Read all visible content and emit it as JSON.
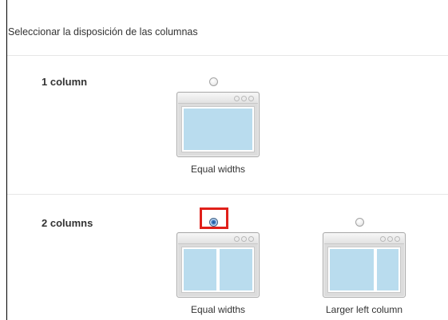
{
  "header": {
    "title": "Seleccionar la disposición de las columnas"
  },
  "rows": [
    {
      "label": "1 column",
      "options": [
        {
          "caption": "Equal widths",
          "selected": false
        }
      ]
    },
    {
      "label": "2 columns",
      "options": [
        {
          "caption": "Equal widths",
          "selected": true
        },
        {
          "caption": "Larger left column",
          "selected": false
        }
      ]
    }
  ],
  "colors": {
    "column_fill": "#b9dcee",
    "highlight": "#e0201a",
    "radio_selected": "#3f7cc6"
  }
}
